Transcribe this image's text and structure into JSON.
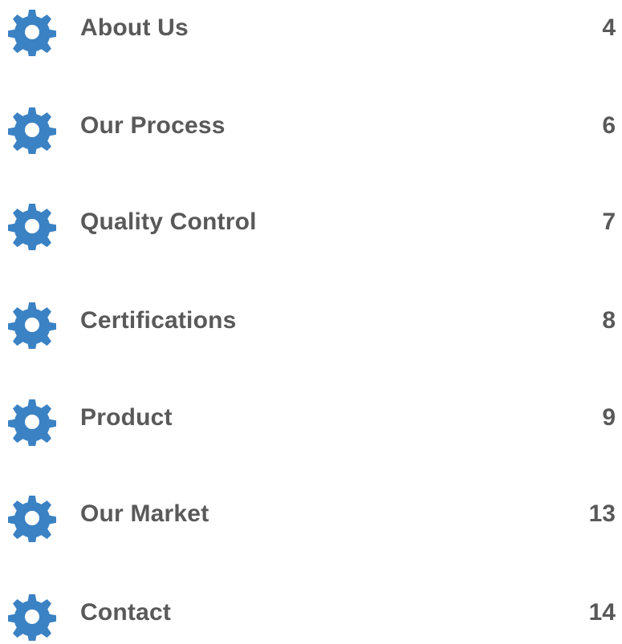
{
  "accent": "#3b82c4",
  "text_color": "#595959",
  "icon": "gear-icon",
  "entries": [
    {
      "label": "About Us",
      "page": "4"
    },
    {
      "label": "Our Process",
      "page": "6"
    },
    {
      "label": "Quality Control",
      "page": "7"
    },
    {
      "label": "Certifications",
      "page": "8"
    },
    {
      "label": "Product",
      "page": "9"
    },
    {
      "label": "Our Market",
      "page": "13"
    },
    {
      "label": "Contact",
      "page": "14"
    }
  ]
}
